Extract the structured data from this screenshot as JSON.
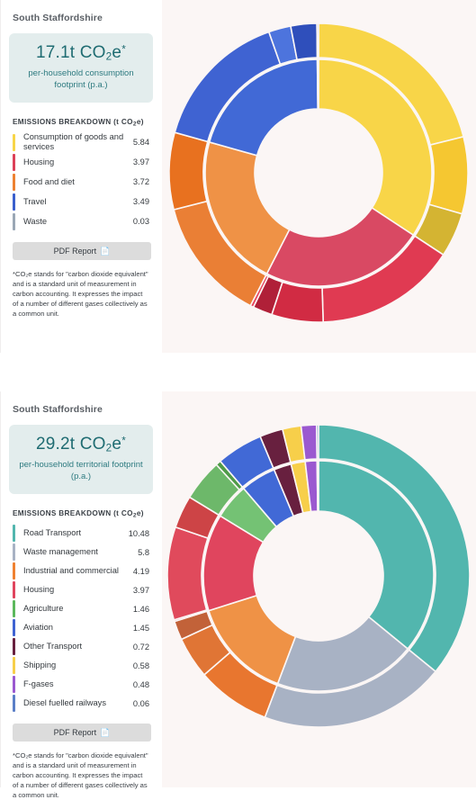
{
  "panels": [
    {
      "id": "consumption",
      "region": "South Staffordshire",
      "headline_value": "17.1t",
      "headline_unit_main": "CO",
      "headline_unit_sub": "2",
      "headline_unit_tail": "e",
      "headline_star": "*",
      "headline_sub": "per-household consumption footprint (p.a.)",
      "breakdown_title_pre": "EMISSIONS BREAKDOWN (t CO",
      "breakdown_title_sub": "2",
      "breakdown_title_post": "e)",
      "pdf_label": "PDF Report",
      "pdf_icon": "document-icon",
      "footnote": "*CO₂e stands for \"carbon dioxide equivalent\" and is a standard unit of measurement in carbon accounting. It expresses the impact of a number of different gases collectively as a common unit."
    },
    {
      "id": "territorial",
      "region": "South Staffordshire",
      "headline_value": "29.2t",
      "headline_unit_main": "CO",
      "headline_unit_sub": "2",
      "headline_unit_tail": "e",
      "headline_star": "*",
      "headline_sub": "per-household territorial footprint (p.a.)",
      "breakdown_title_pre": "EMISSIONS BREAKDOWN (t CO",
      "breakdown_title_sub": "2",
      "breakdown_title_post": "e)",
      "pdf_label": "PDF Report",
      "pdf_icon": "document-icon",
      "footnote": "*CO₂e stands for \"carbon dioxide equivalent\" and is a standard unit of measurement in carbon accounting. It expresses the impact of a number of different gases collectively as a common unit."
    }
  ],
  "chart_data": [
    {
      "type": "pie",
      "subtype": "sunburst",
      "title": "South Staffordshire per-household consumption footprint (t CO2e)",
      "total": 17.1,
      "unit": "t CO2e",
      "legend_position": "left",
      "categories": [
        "Consumption of goods and services",
        "Housing",
        "Food and diet",
        "Travel",
        "Waste"
      ],
      "values": [
        5.84,
        3.97,
        3.72,
        3.49,
        0.03
      ],
      "colors": [
        "#f8d548",
        "#dc4058",
        "#ed8131",
        "#3a5fcd",
        "#9aa7b5"
      ],
      "inner_ring": [
        {
          "label": "Consumption of goods and services",
          "value": 5.84,
          "color": "#f8d548"
        },
        {
          "label": "Housing",
          "value": 3.97,
          "color": "#d94963"
        },
        {
          "label": "Food and diet",
          "value": 3.72,
          "color": "#ef9246"
        },
        {
          "label": "Travel",
          "value": 3.49,
          "color": "#4169d6"
        },
        {
          "label": "Waste",
          "value": 0.03,
          "color": "#9aa7b5"
        }
      ],
      "outer_ring": [
        {
          "parent": "Consumption of goods and services",
          "value": 3.6,
          "color": "#f8d548"
        },
        {
          "parent": "Consumption of goods and services",
          "value": 1.42,
          "color": "#f5c731"
        },
        {
          "parent": "Consumption of goods and services",
          "value": 0.82,
          "color": "#d4b432"
        },
        {
          "parent": "Housing",
          "value": 2.6,
          "color": "#e03a52"
        },
        {
          "parent": "Housing",
          "value": 0.95,
          "color": "#d12b43"
        },
        {
          "parent": "Housing",
          "value": 0.36,
          "color": "#b02038"
        },
        {
          "parent": "Housing",
          "value": 0.06,
          "color": "#e8475f"
        },
        {
          "parent": "Food and diet",
          "value": 2.3,
          "color": "#ea7f35"
        },
        {
          "parent": "Food and diet",
          "value": 1.42,
          "color": "#e8711f"
        },
        {
          "parent": "Travel",
          "value": 2.6,
          "color": "#3f63d2"
        },
        {
          "parent": "Travel",
          "value": 0.41,
          "color": "#4d74dd"
        },
        {
          "parent": "Travel",
          "value": 0.48,
          "color": "#2f4fbb"
        },
        {
          "parent": "Waste",
          "value": 0.03,
          "color": "#9aa7b5"
        }
      ]
    },
    {
      "type": "pie",
      "subtype": "sunburst",
      "title": "South Staffordshire per-household territorial footprint (t CO2e)",
      "total": 29.2,
      "unit": "t CO2e",
      "legend_position": "left",
      "categories": [
        "Road Transport",
        "Waste management",
        "Industrial and commercial",
        "Housing",
        "Agriculture",
        "Aviation",
        "Other Transport",
        "Shipping",
        "F-gases",
        "Diesel fuelled railways"
      ],
      "values": [
        10.48,
        5.8,
        4.19,
        3.97,
        1.46,
        1.45,
        0.72,
        0.58,
        0.48,
        0.06
      ],
      "colors": [
        "#52b6ae",
        "#a8b2c4",
        "#ef8131",
        "#e0455e",
        "#5cb85c",
        "#3f63d2",
        "#68203f",
        "#f7cf4a",
        "#9b59d0",
        "#5b7fc7"
      ],
      "inner_ring": [
        {
          "label": "Road Transport",
          "value": 10.48,
          "color": "#52b6ae"
        },
        {
          "label": "Waste management",
          "value": 5.8,
          "color": "#a8b2c4"
        },
        {
          "label": "Industrial and commercial",
          "value": 4.19,
          "color": "#ef9246"
        },
        {
          "label": "Housing",
          "value": 3.97,
          "color": "#e0455e"
        },
        {
          "label": "Agriculture",
          "value": 1.46,
          "color": "#74c274"
        },
        {
          "label": "Aviation",
          "value": 1.45,
          "color": "#4169d6"
        },
        {
          "label": "Other Transport",
          "value": 0.72,
          "color": "#68203f"
        },
        {
          "label": "Shipping",
          "value": 0.58,
          "color": "#f7cf4a"
        },
        {
          "label": "F-gases",
          "value": 0.48,
          "color": "#9b59d0"
        },
        {
          "label": "Diesel fuelled railways",
          "value": 0.06,
          "color": "#5b7fc7"
        }
      ],
      "outer_ring": [
        {
          "parent": "Road Transport",
          "value": 10.48,
          "color": "#52b6ae"
        },
        {
          "parent": "Waste management",
          "value": 5.8,
          "color": "#a8b2c4"
        },
        {
          "parent": "Industrial and commercial",
          "value": 2.3,
          "color": "#e8762f"
        },
        {
          "parent": "Industrial and commercial",
          "value": 1.3,
          "color": "#e07535"
        },
        {
          "parent": "Industrial and commercial",
          "value": 0.59,
          "color": "#c26239"
        },
        {
          "parent": "Housing",
          "value": 0.05,
          "color": "#e0455e"
        },
        {
          "parent": "Housing",
          "value": 2.9,
          "color": "#e04a5c"
        },
        {
          "parent": "Housing",
          "value": 1.02,
          "color": "#cd4446"
        },
        {
          "parent": "Agriculture",
          "value": 1.3,
          "color": "#6db86a"
        },
        {
          "parent": "Agriculture",
          "value": 0.16,
          "color": "#4f9b48"
        },
        {
          "parent": "Aviation",
          "value": 1.45,
          "color": "#4169d6"
        },
        {
          "parent": "Other Transport",
          "value": 0.72,
          "color": "#68203f"
        },
        {
          "parent": "Shipping",
          "value": 0.58,
          "color": "#f7cf4a"
        },
        {
          "parent": "F-gases",
          "value": 0.48,
          "color": "#9b59d0"
        },
        {
          "parent": "Diesel fuelled railways",
          "value": 0.06,
          "color": "#5b7fc7"
        }
      ]
    }
  ]
}
